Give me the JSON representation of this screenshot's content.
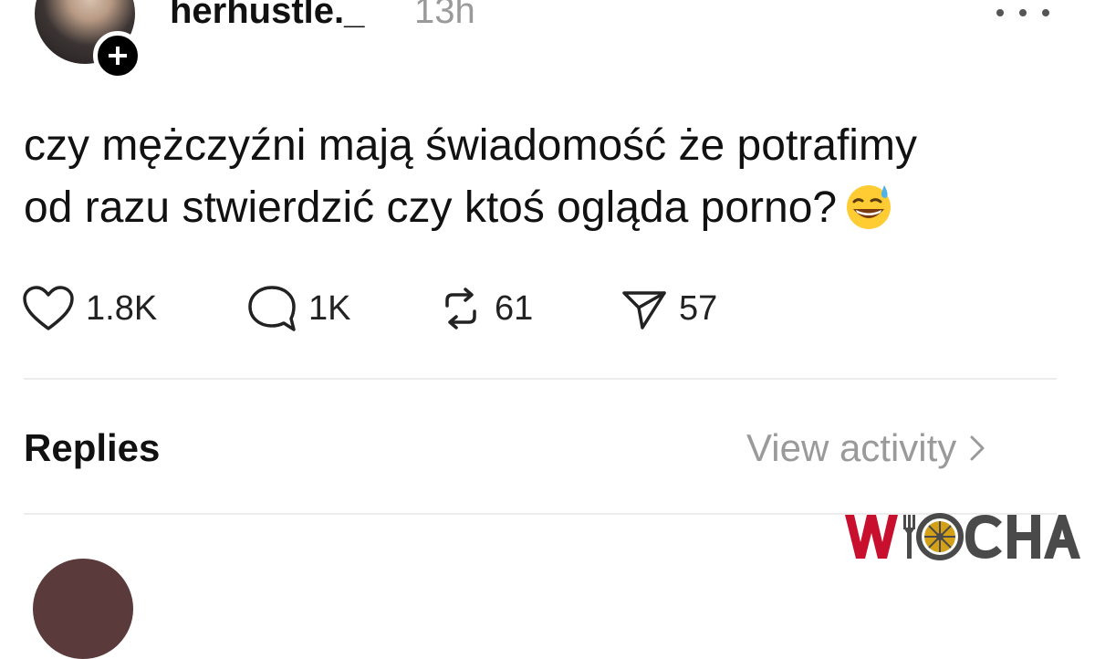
{
  "post": {
    "username": "herhustle._",
    "time": "13h",
    "text_lines": [
      "czy mężczyźni mają świadomość że potrafimy",
      "od razu stwierdzić czy ktoś ogląda porno?"
    ],
    "emoji": "grinning-face-with-sweat"
  },
  "actions": {
    "likes": "1.8K",
    "comments": "1K",
    "reposts": "61",
    "shares": "57"
  },
  "replies_section": {
    "title": "Replies",
    "view_activity": "View activity"
  },
  "watermark": {
    "text": "WIOCHA",
    "colors": {
      "red": "#c8102e",
      "gray": "#4a4a4a",
      "gold": "#d4a017"
    }
  },
  "colors": {
    "text": "#111111",
    "muted": "#9a9a9a",
    "divider": "#ececec",
    "background": "#ffffff"
  }
}
